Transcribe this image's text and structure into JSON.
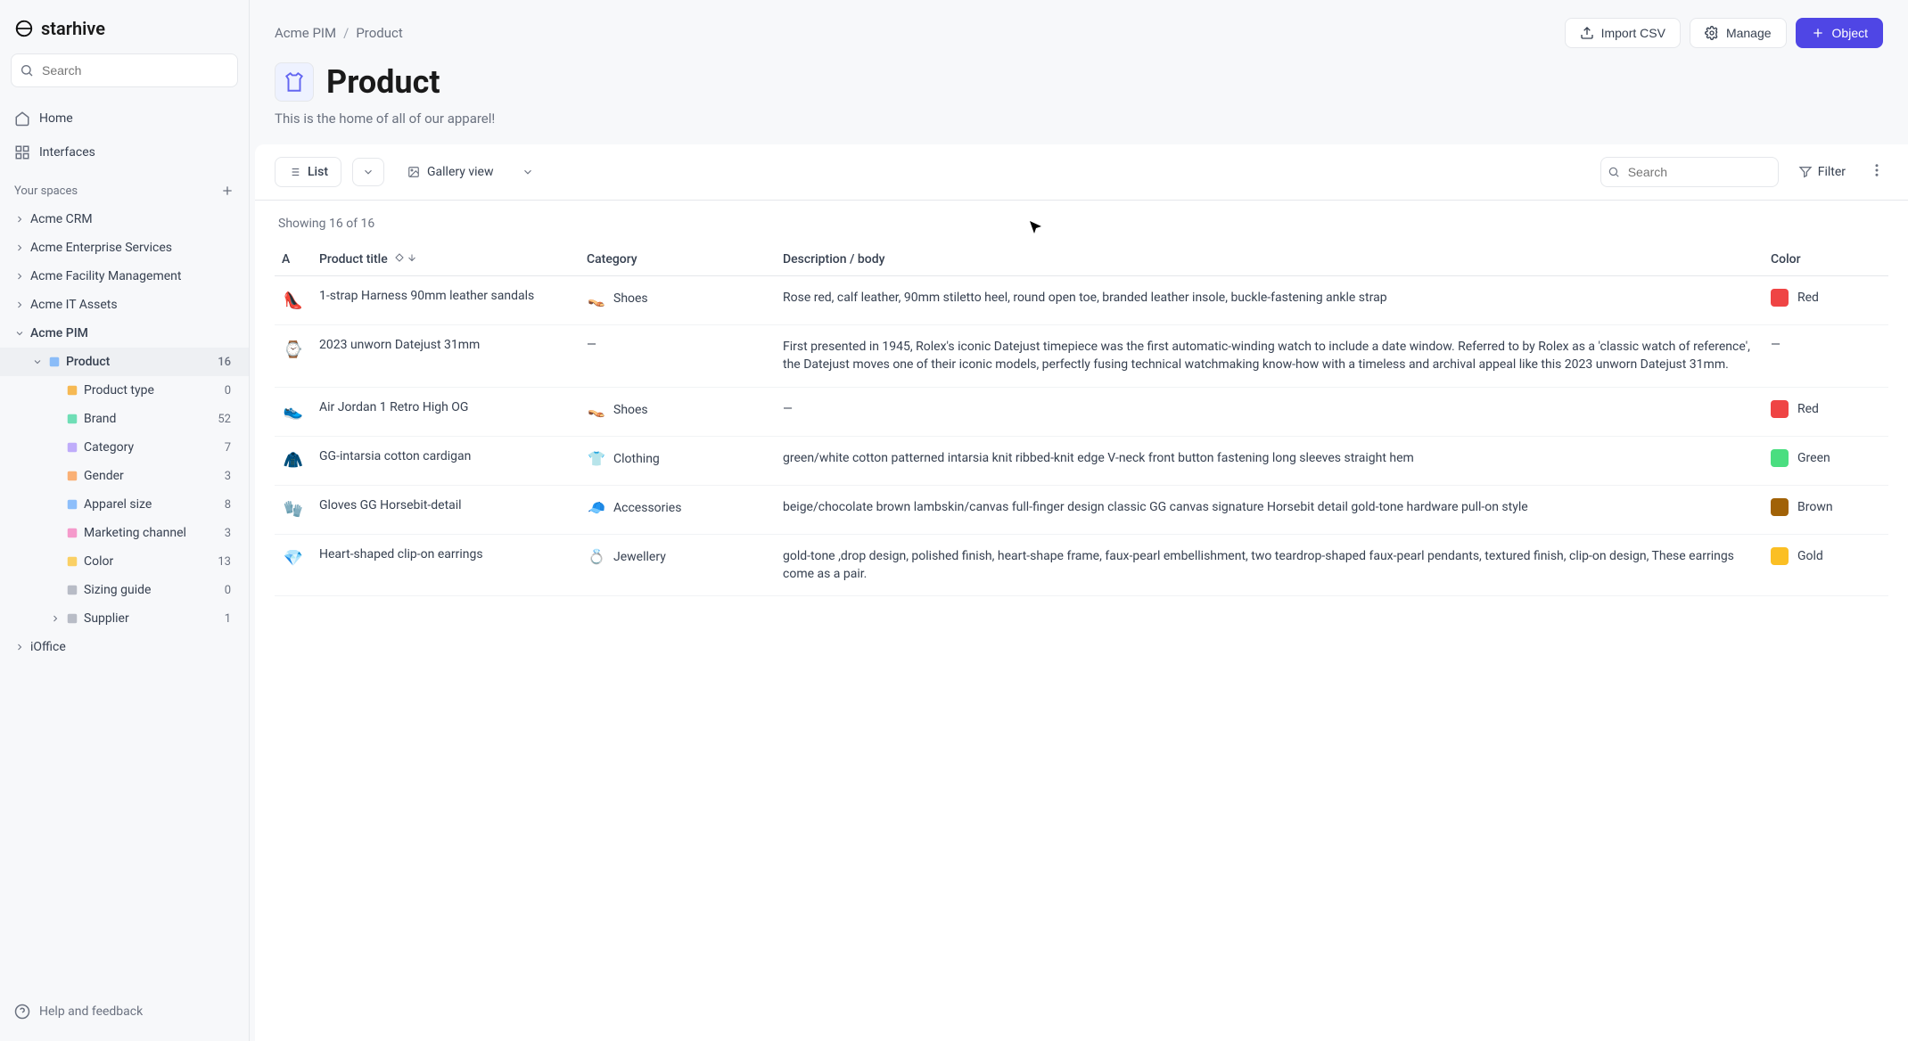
{
  "brand": "starhive",
  "sidebar": {
    "search_placeholder": "Search",
    "nav": {
      "home": "Home",
      "interfaces": "Interfaces"
    },
    "spaces_header": "Your spaces",
    "spaces": [
      {
        "label": "Acme CRM",
        "expanded": false
      },
      {
        "label": "Acme Enterprise Services",
        "expanded": false
      },
      {
        "label": "Acme Facility Management",
        "expanded": false
      },
      {
        "label": "Acme IT Assets",
        "expanded": false
      },
      {
        "label": "Acme PIM",
        "expanded": true
      },
      {
        "label": "iOffice",
        "expanded": false
      }
    ],
    "pim_children": [
      {
        "label": "Product",
        "count": "16",
        "selected": true,
        "iconColor": "#60a5fa"
      },
      {
        "label": "Product type",
        "count": "0",
        "indent": 2,
        "iconColor": "#f59e0b"
      },
      {
        "label": "Brand",
        "count": "52",
        "indent": 2,
        "iconColor": "#34d399"
      },
      {
        "label": "Category",
        "count": "7",
        "indent": 2,
        "iconColor": "#a78bfa"
      },
      {
        "label": "Gender",
        "count": "3",
        "indent": 2,
        "iconColor": "#fb923c"
      },
      {
        "label": "Apparel size",
        "count": "8",
        "indent": 2,
        "iconColor": "#60a5fa"
      },
      {
        "label": "Marketing channel",
        "count": "3",
        "indent": 2,
        "iconColor": "#f472b6"
      },
      {
        "label": "Color",
        "count": "13",
        "indent": 2,
        "iconColor": "#fbbf24"
      },
      {
        "label": "Sizing guide",
        "count": "0",
        "indent": 2,
        "iconColor": "#9ca3af"
      },
      {
        "label": "Supplier",
        "count": "1",
        "indent": 2,
        "iconColor": "#9ca3af",
        "expandable": true
      }
    ],
    "help": "Help and feedback"
  },
  "breadcrumb": {
    "space": "Acme PIM",
    "type": "Product"
  },
  "header_actions": {
    "import": "Import CSV",
    "manage": "Manage",
    "object": "Object"
  },
  "page": {
    "title": "Product",
    "description": "This is the home of all of our apparel!"
  },
  "toolbar": {
    "list": "List",
    "gallery": "Gallery view",
    "search_placeholder": "Search",
    "filter": "Filter"
  },
  "showing": "Showing 16 of 16",
  "columns": {
    "a": "A",
    "title": "Product title",
    "category": "Category",
    "description": "Description / body",
    "color": "Color"
  },
  "rows": [
    {
      "thumb": "👠",
      "title": "1-strap Harness 90mm leather sandals",
      "category": "Shoes",
      "cat_icon": "👡",
      "description": "Rose red, calf leather, 90mm stiletto heel, round open toe, branded leather insole, buckle-fastening ankle strap",
      "color": "Red",
      "swatch": "#ef4444"
    },
    {
      "thumb": "⌚",
      "title": "2023 unworn Datejust 31mm",
      "category": "—",
      "cat_icon": "",
      "description": "First presented in 1945, Rolex's iconic Datejust timepiece was the first automatic-winding watch to include a date window. Referred to by Rolex as a 'classic watch of reference', the Datejust moves one of their iconic models, perfectly fusing technical watchmaking know-how with a timeless and archival appeal like this 2023 unworn Datejust 31mm.",
      "color": "—",
      "swatch": ""
    },
    {
      "thumb": "👟",
      "title": "Air Jordan 1 Retro High OG",
      "category": "Shoes",
      "cat_icon": "👡",
      "description": "—",
      "color": "Red",
      "swatch": "#ef4444"
    },
    {
      "thumb": "🧥",
      "title": "GG-intarsia cotton cardigan",
      "category": "Clothing",
      "cat_icon": "👕",
      "description": "green/white cotton patterned intarsia knit ribbed-knit edge V-neck front button fastening long sleeves straight hem",
      "color": "Green",
      "swatch": "#4ade80"
    },
    {
      "thumb": "🧤",
      "title": "Gloves GG Horsebit-detail",
      "category": "Accessories",
      "cat_icon": "🧢",
      "description": "beige/chocolate brown lambskin/canvas full-finger design classic GG canvas signature Horsebit detail gold-tone hardware pull-on style",
      "color": "Brown",
      "swatch": "#a16207"
    },
    {
      "thumb": "💎",
      "title": "Heart-shaped clip-on earrings",
      "category": "Jewellery",
      "cat_icon": "💍",
      "description": "gold-tone ,drop design, polished finish, heart-shape frame, faux-pearl embellishment, two teardrop-shaped faux-pearl pendants, textured finish, clip-on design, These earrings come as a pair.",
      "color": "Gold",
      "swatch": "#fbbf24"
    }
  ]
}
